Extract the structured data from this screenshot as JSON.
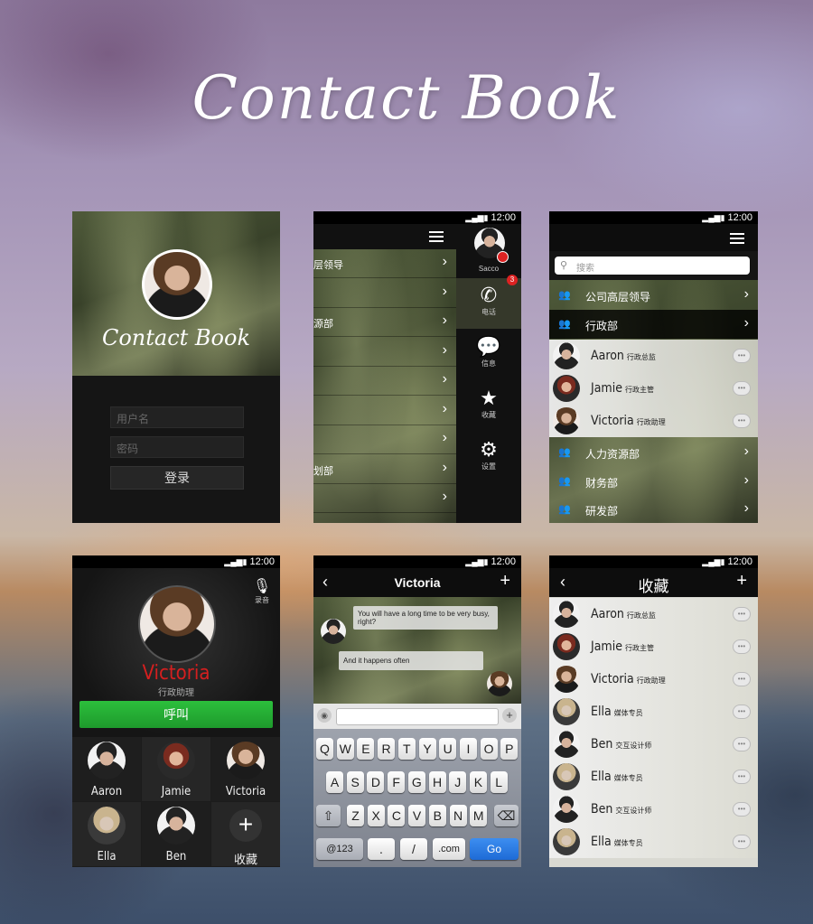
{
  "title": "Contact Book",
  "status_time": "12:00",
  "login": {
    "brand": "Contact Book",
    "username_placeholder": "用户名",
    "password_placeholder": "密码",
    "login_label": "登录"
  },
  "drawer": {
    "menu_rows": [
      "层领导",
      "",
      "源部",
      "",
      "",
      "",
      "",
      "划部",
      ""
    ],
    "user_name": "Sacco",
    "items": [
      {
        "label": "电话",
        "icon": "phone-icon",
        "badge": "3"
      },
      {
        "label": "信息",
        "icon": "message-icon"
      },
      {
        "label": "收藏",
        "icon": "star-icon"
      },
      {
        "label": "设置",
        "icon": "gear-icon"
      }
    ]
  },
  "contacts": {
    "search_placeholder": "搜索",
    "groups_top": [
      "公司高层领导",
      "行政部"
    ],
    "people": [
      {
        "name": "Aaron",
        "role": "行政总监"
      },
      {
        "name": "Jamie",
        "role": "行政主管"
      },
      {
        "name": "Victoria",
        "role": "行政助理"
      }
    ],
    "groups_bottom": [
      "人力资源部",
      "财务部",
      "研发部"
    ]
  },
  "call": {
    "record_label": "录音",
    "name": "Victoria",
    "role": "行政助理",
    "call_label": "呼叫",
    "quick": [
      {
        "name": "Aaron"
      },
      {
        "name": "Jamie"
      },
      {
        "name": "Victoria"
      },
      {
        "name": "Ella"
      },
      {
        "name": "Ben"
      },
      {
        "name": "收藏"
      }
    ]
  },
  "chat": {
    "title": "Victoria",
    "messages": [
      {
        "text": "You will have a long time to be very busy, right?"
      },
      {
        "text": "And it happens often"
      }
    ],
    "keys_row1": [
      "Q",
      "W",
      "E",
      "R",
      "T",
      "Y",
      "U",
      "I",
      "O",
      "P"
    ],
    "keys_row2": [
      "A",
      "S",
      "D",
      "F",
      "G",
      "H",
      "J",
      "K",
      "L"
    ],
    "keys_row3": [
      "Z",
      "X",
      "C",
      "V",
      "B",
      "N",
      "M"
    ],
    "bottom": {
      "num": "@123",
      "dot": ".",
      "slash": "/",
      "com": ".com",
      "go": "Go"
    }
  },
  "favorites": {
    "title": "收藏",
    "people": [
      {
        "name": "Aaron",
        "role": "行政总监"
      },
      {
        "name": "Jamie",
        "role": "行政主管"
      },
      {
        "name": "Victoria",
        "role": "行政助理"
      },
      {
        "name": "Ella",
        "role": "媒体专员"
      },
      {
        "name": "Ben",
        "role": "交互设计师"
      },
      {
        "name": "Ella",
        "role": "媒体专员"
      },
      {
        "name": "Ben",
        "role": "交互设计师"
      },
      {
        "name": "Ella",
        "role": "媒体专员"
      }
    ]
  }
}
